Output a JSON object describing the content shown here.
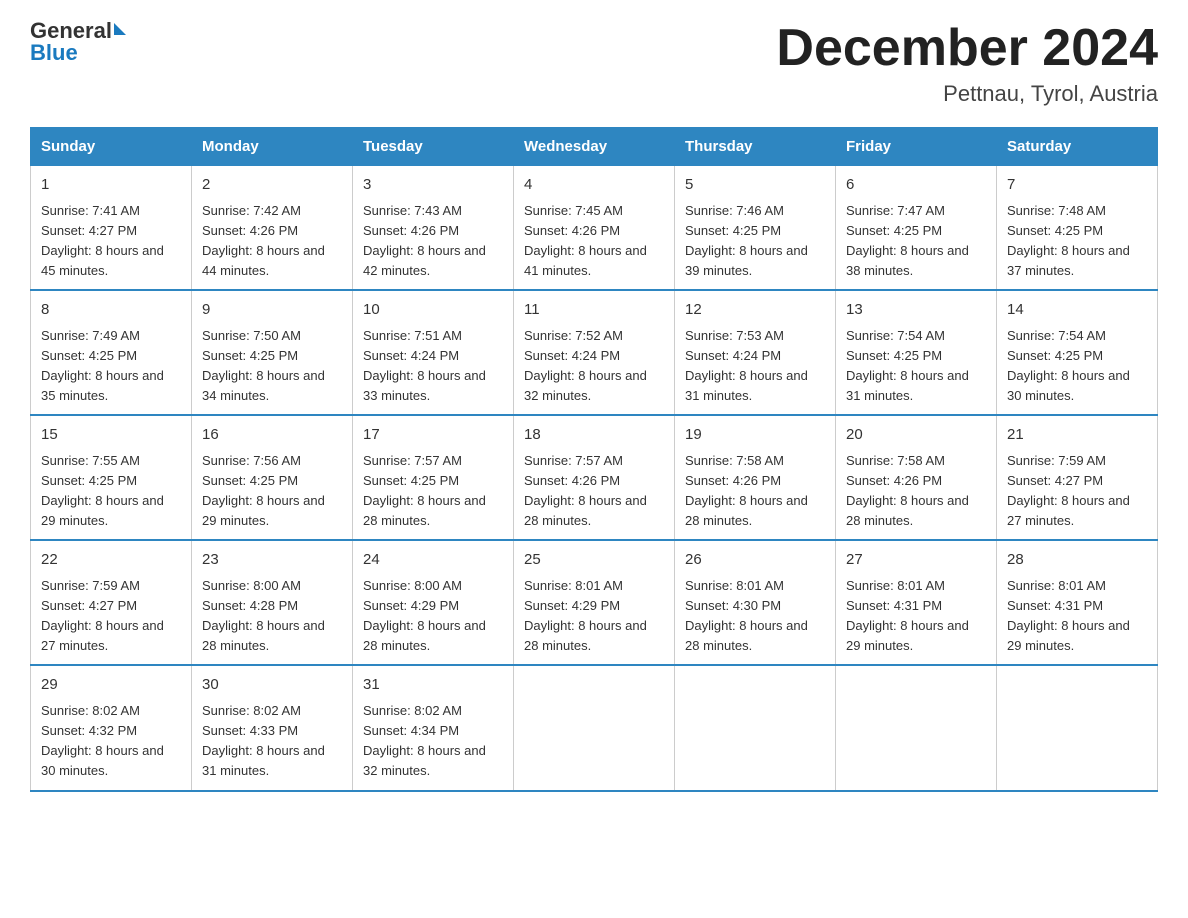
{
  "logo": {
    "part1": "General",
    "part2": "Blue"
  },
  "header": {
    "month_title": "December 2024",
    "location": "Pettnau, Tyrol, Austria"
  },
  "days_of_week": [
    "Sunday",
    "Monday",
    "Tuesday",
    "Wednesday",
    "Thursday",
    "Friday",
    "Saturday"
  ],
  "weeks": [
    [
      {
        "day": "1",
        "sunrise": "7:41 AM",
        "sunset": "4:27 PM",
        "daylight": "8 hours and 45 minutes."
      },
      {
        "day": "2",
        "sunrise": "7:42 AM",
        "sunset": "4:26 PM",
        "daylight": "8 hours and 44 minutes."
      },
      {
        "day": "3",
        "sunrise": "7:43 AM",
        "sunset": "4:26 PM",
        "daylight": "8 hours and 42 minutes."
      },
      {
        "day": "4",
        "sunrise": "7:45 AM",
        "sunset": "4:26 PM",
        "daylight": "8 hours and 41 minutes."
      },
      {
        "day": "5",
        "sunrise": "7:46 AM",
        "sunset": "4:25 PM",
        "daylight": "8 hours and 39 minutes."
      },
      {
        "day": "6",
        "sunrise": "7:47 AM",
        "sunset": "4:25 PM",
        "daylight": "8 hours and 38 minutes."
      },
      {
        "day": "7",
        "sunrise": "7:48 AM",
        "sunset": "4:25 PM",
        "daylight": "8 hours and 37 minutes."
      }
    ],
    [
      {
        "day": "8",
        "sunrise": "7:49 AM",
        "sunset": "4:25 PM",
        "daylight": "8 hours and 35 minutes."
      },
      {
        "day": "9",
        "sunrise": "7:50 AM",
        "sunset": "4:25 PM",
        "daylight": "8 hours and 34 minutes."
      },
      {
        "day": "10",
        "sunrise": "7:51 AM",
        "sunset": "4:24 PM",
        "daylight": "8 hours and 33 minutes."
      },
      {
        "day": "11",
        "sunrise": "7:52 AM",
        "sunset": "4:24 PM",
        "daylight": "8 hours and 32 minutes."
      },
      {
        "day": "12",
        "sunrise": "7:53 AM",
        "sunset": "4:24 PM",
        "daylight": "8 hours and 31 minutes."
      },
      {
        "day": "13",
        "sunrise": "7:54 AM",
        "sunset": "4:25 PM",
        "daylight": "8 hours and 31 minutes."
      },
      {
        "day": "14",
        "sunrise": "7:54 AM",
        "sunset": "4:25 PM",
        "daylight": "8 hours and 30 minutes."
      }
    ],
    [
      {
        "day": "15",
        "sunrise": "7:55 AM",
        "sunset": "4:25 PM",
        "daylight": "8 hours and 29 minutes."
      },
      {
        "day": "16",
        "sunrise": "7:56 AM",
        "sunset": "4:25 PM",
        "daylight": "8 hours and 29 minutes."
      },
      {
        "day": "17",
        "sunrise": "7:57 AM",
        "sunset": "4:25 PM",
        "daylight": "8 hours and 28 minutes."
      },
      {
        "day": "18",
        "sunrise": "7:57 AM",
        "sunset": "4:26 PM",
        "daylight": "8 hours and 28 minutes."
      },
      {
        "day": "19",
        "sunrise": "7:58 AM",
        "sunset": "4:26 PM",
        "daylight": "8 hours and 28 minutes."
      },
      {
        "day": "20",
        "sunrise": "7:58 AM",
        "sunset": "4:26 PM",
        "daylight": "8 hours and 28 minutes."
      },
      {
        "day": "21",
        "sunrise": "7:59 AM",
        "sunset": "4:27 PM",
        "daylight": "8 hours and 27 minutes."
      }
    ],
    [
      {
        "day": "22",
        "sunrise": "7:59 AM",
        "sunset": "4:27 PM",
        "daylight": "8 hours and 27 minutes."
      },
      {
        "day": "23",
        "sunrise": "8:00 AM",
        "sunset": "4:28 PM",
        "daylight": "8 hours and 28 minutes."
      },
      {
        "day": "24",
        "sunrise": "8:00 AM",
        "sunset": "4:29 PM",
        "daylight": "8 hours and 28 minutes."
      },
      {
        "day": "25",
        "sunrise": "8:01 AM",
        "sunset": "4:29 PM",
        "daylight": "8 hours and 28 minutes."
      },
      {
        "day": "26",
        "sunrise": "8:01 AM",
        "sunset": "4:30 PM",
        "daylight": "8 hours and 28 minutes."
      },
      {
        "day": "27",
        "sunrise": "8:01 AM",
        "sunset": "4:31 PM",
        "daylight": "8 hours and 29 minutes."
      },
      {
        "day": "28",
        "sunrise": "8:01 AM",
        "sunset": "4:31 PM",
        "daylight": "8 hours and 29 minutes."
      }
    ],
    [
      {
        "day": "29",
        "sunrise": "8:02 AM",
        "sunset": "4:32 PM",
        "daylight": "8 hours and 30 minutes."
      },
      {
        "day": "30",
        "sunrise": "8:02 AM",
        "sunset": "4:33 PM",
        "daylight": "8 hours and 31 minutes."
      },
      {
        "day": "31",
        "sunrise": "8:02 AM",
        "sunset": "4:34 PM",
        "daylight": "8 hours and 32 minutes."
      },
      null,
      null,
      null,
      null
    ]
  ]
}
